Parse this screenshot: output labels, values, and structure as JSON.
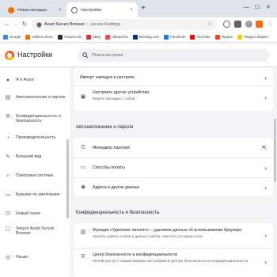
{
  "tabs": [
    {
      "label": "Новая вкладка",
      "close": "×",
      "favicon_color": "#ff6a00"
    },
    {
      "label": "Настройки",
      "close": "×",
      "favicon_color": "#5f6368"
    }
  ],
  "new_tab": "+",
  "window_controls": {
    "minimize": "—",
    "maximize": "☐",
    "close": "✕"
  },
  "toolbar": {
    "back": "←",
    "forward": "→",
    "reload": "↻",
    "brand": "Avast Secure Browser",
    "separator": "|",
    "url": "secure://settings",
    "star": "☆"
  },
  "bookmarks": [
    {
      "label": "Google",
      "color": "#4285f4"
    },
    {
      "label": "Addons Store",
      "color": "#ff6a00"
    },
    {
      "label": "Amazon.de",
      "color": "#232f3e"
    },
    {
      "label": "eBay",
      "color": "#e53238"
    },
    {
      "label": "AliExpress",
      "color": "#ff4747"
    },
    {
      "label": "Booking.com",
      "color": "#003580"
    },
    {
      "label": "Facebook",
      "color": "#1877f2"
    },
    {
      "label": "YouTube",
      "color": "#ff0000"
    },
    {
      "label": "Яндекс",
      "color": "#fc3f1d"
    },
    {
      "label": "Яндекс Маркет",
      "color": "#ffcc00"
    }
  ],
  "header": {
    "title": "Настройки",
    "search_placeholder": "Поиск настроек"
  },
  "sidebar": {
    "items": [
      {
        "label": "Я и Avast",
        "icon": "person-icon",
        "glyph": "👤"
      },
      {
        "label": "Автозаполнение и пароли",
        "icon": "autofill-icon",
        "glyph": "▤"
      },
      {
        "label": "Конфиденциальность и безопасность",
        "icon": "shield-icon",
        "glyph": "⛨"
      },
      {
        "label": "Производительность",
        "icon": "performance-icon",
        "glyph": "◔"
      },
      {
        "label": "Внешний вид",
        "icon": "palette-icon",
        "glyph": "✎"
      },
      {
        "label": "Поисковая система",
        "icon": "search-icon",
        "glyph": "⌕"
      },
      {
        "label": "Браузер по умолчанию",
        "icon": "browser-icon",
        "glyph": "▭"
      },
      {
        "label": "Новый сеанс",
        "icon": "power-icon",
        "glyph": "⏻"
      },
      {
        "label": "Запуск Avast Secure Browser",
        "icon": "launch-icon",
        "glyph": "▢"
      },
      {
        "label": "Языки",
        "icon": "language-icon",
        "glyph": "◎"
      }
    ]
  },
  "main": {
    "top_card": [
      {
        "label": "Импорт закладок и настроек",
        "icon": "",
        "arrow": "›"
      },
      {
        "label": "Настроить другие устройства",
        "sub": "Берите закладки с собой",
        "icon": "sync-icon",
        "glyph": "▣",
        "arrow": "›"
      }
    ],
    "autofill_title": "Автозаполнение и пароли",
    "autofill_rows": [
      {
        "label": "Менеджер паролей",
        "icon": "key-icon",
        "glyph": "⚿",
        "arrow": "⇱"
      },
      {
        "label": "Способы оплаты",
        "icon": "card-icon",
        "glyph": "▭",
        "arrow": "›"
      },
      {
        "label": "Адреса и другие данные",
        "icon": "location-icon",
        "glyph": "◉",
        "arrow": "›"
      }
    ],
    "privacy_title": "Конфиденциальность и безопасность",
    "privacy_rows": [
      {
        "label": "Функция «Удаление личного» – удаление данных об использовании браузера",
        "sub": "Удалить файлы cookie и данные сайтов, очистить историю и кэш",
        "icon": "trash-icon",
        "glyph": "🗑",
        "arrow": "›"
      },
      {
        "label": "Центр безопасности и конфиденциальности",
        "sub": "Легкий доступ к самым важным настройкам в Центре безопасности и конфиденциальности",
        "icon": "security-shield-icon",
        "glyph": "⛨",
        "arrow": "›"
      }
    ]
  },
  "colors": {
    "accent": "#1a73e8",
    "header_bg": "#ffffff",
    "page_bg": "#f3f4f6"
  }
}
